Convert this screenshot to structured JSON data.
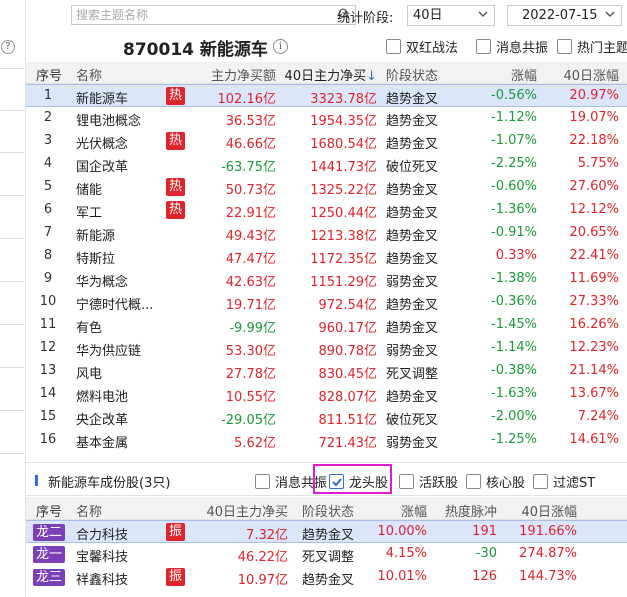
{
  "search": {
    "placeholder": "搜索主题名称"
  },
  "stat": {
    "label": "统计阶段:",
    "period": "40日",
    "date": "2022-07-15"
  },
  "board": {
    "title": "870014 新能源车",
    "options": [
      {
        "label": "双红战法",
        "checked": false
      },
      {
        "label": "消息共振",
        "checked": false
      },
      {
        "label": "热门主题",
        "checked": false
      }
    ]
  },
  "main_table": {
    "headers": {
      "idx": "序号",
      "name": "名称",
      "net": "主力净买额",
      "net40": "40日主力净买",
      "status": "阶段状态",
      "chg": "涨幅",
      "chg40": "40日涨幅"
    },
    "hot_label": "热",
    "rows": [
      {
        "idx": "1",
        "name": "新能源车",
        "hot": true,
        "net": "102.16亿",
        "net_color": "red",
        "net40": "3323.78亿",
        "status": "趋势金叉",
        "chg": "-0.56%",
        "chg_color": "green",
        "chg40": "20.97%"
      },
      {
        "idx": "2",
        "name": "锂电池概念",
        "hot": false,
        "net": "36.53亿",
        "net_color": "red",
        "net40": "1954.35亿",
        "status": "趋势金叉",
        "chg": "-1.12%",
        "chg_color": "green",
        "chg40": "19.07%"
      },
      {
        "idx": "3",
        "name": "光伏概念",
        "hot": true,
        "net": "46.66亿",
        "net_color": "red",
        "net40": "1680.54亿",
        "status": "趋势金叉",
        "chg": "-1.07%",
        "chg_color": "green",
        "chg40": "22.18%"
      },
      {
        "idx": "4",
        "name": "国企改革",
        "hot": false,
        "net": "-63.75亿",
        "net_color": "green",
        "net40": "1441.73亿",
        "status": "破位死叉",
        "chg": "-2.25%",
        "chg_color": "green",
        "chg40": "5.75%"
      },
      {
        "idx": "5",
        "name": "储能",
        "hot": true,
        "net": "50.73亿",
        "net_color": "red",
        "net40": "1325.22亿",
        "status": "趋势金叉",
        "chg": "-0.60%",
        "chg_color": "green",
        "chg40": "27.60%"
      },
      {
        "idx": "6",
        "name": "军工",
        "hot": true,
        "net": "22.91亿",
        "net_color": "red",
        "net40": "1250.44亿",
        "status": "趋势金叉",
        "chg": "-1.36%",
        "chg_color": "green",
        "chg40": "12.12%"
      },
      {
        "idx": "7",
        "name": "新能源",
        "hot": false,
        "net": "49.43亿",
        "net_color": "red",
        "net40": "1213.38亿",
        "status": "趋势金叉",
        "chg": "-0.91%",
        "chg_color": "green",
        "chg40": "20.65%"
      },
      {
        "idx": "8",
        "name": "特斯拉",
        "hot": false,
        "net": "47.47亿",
        "net_color": "red",
        "net40": "1172.35亿",
        "status": "趋势金叉",
        "chg": "0.33%",
        "chg_color": "red",
        "chg40": "22.41%"
      },
      {
        "idx": "9",
        "name": "华为概念",
        "hot": false,
        "net": "42.63亿",
        "net_color": "red",
        "net40": "1151.29亿",
        "status": "弱势金叉",
        "chg": "-1.38%",
        "chg_color": "green",
        "chg40": "11.69%"
      },
      {
        "idx": "10",
        "name": "宁德时代概...",
        "hot": false,
        "net": "19.71亿",
        "net_color": "red",
        "net40": "972.54亿",
        "status": "趋势金叉",
        "chg": "-0.36%",
        "chg_color": "green",
        "chg40": "27.33%"
      },
      {
        "idx": "11",
        "name": "有色",
        "hot": false,
        "net": "-9.99亿",
        "net_color": "green",
        "net40": "960.17亿",
        "status": "趋势金叉",
        "chg": "-1.45%",
        "chg_color": "green",
        "chg40": "16.26%"
      },
      {
        "idx": "12",
        "name": "华为供应链",
        "hot": false,
        "net": "53.30亿",
        "net_color": "red",
        "net40": "890.78亿",
        "status": "弱势金叉",
        "chg": "-1.14%",
        "chg_color": "green",
        "chg40": "12.23%"
      },
      {
        "idx": "13",
        "name": "风电",
        "hot": false,
        "net": "27.78亿",
        "net_color": "red",
        "net40": "830.45亿",
        "status": "死叉调整",
        "chg": "-0.38%",
        "chg_color": "green",
        "chg40": "21.14%"
      },
      {
        "idx": "14",
        "name": "燃料电池",
        "hot": false,
        "net": "10.55亿",
        "net_color": "red",
        "net40": "828.07亿",
        "status": "趋势金叉",
        "chg": "-1.63%",
        "chg_color": "green",
        "chg40": "13.67%"
      },
      {
        "idx": "15",
        "name": "央企改革",
        "hot": false,
        "net": "-29.05亿",
        "net_color": "green",
        "net40": "811.51亿",
        "status": "破位死叉",
        "chg": "-2.00%",
        "chg_color": "green",
        "chg40": "7.24%"
      },
      {
        "idx": "16",
        "name": "基本金属",
        "hot": false,
        "net": "5.62亿",
        "net_color": "red",
        "net40": "721.43亿",
        "status": "弱势金叉",
        "chg": "-1.25%",
        "chg_color": "green",
        "chg40": "14.61%"
      }
    ]
  },
  "constituents": {
    "title": "新能源车成份股(3只)",
    "filters": [
      {
        "label": "消息共振",
        "checked": false
      },
      {
        "label": "龙头股",
        "checked": true
      },
      {
        "label": "活跃股",
        "checked": false
      },
      {
        "label": "核心股",
        "checked": false
      },
      {
        "label": "过滤ST",
        "checked": false
      }
    ],
    "headers": {
      "idx": "序号",
      "name": "名称",
      "net40": "40日主力净买",
      "status": "阶段状态",
      "chg": "涨幅",
      "heat": "热度脉冲",
      "chg40": "40日涨幅"
    },
    "zhen_label": "振",
    "rows": [
      {
        "tag": "龙二",
        "name": "合力科技",
        "zhen": true,
        "net40": "7.32亿",
        "status": "趋势金叉",
        "chg": "10.00%",
        "heat": "191",
        "heat_color": "red",
        "chg40": "191.66%"
      },
      {
        "tag": "龙一",
        "name": "宝馨科技",
        "zhen": false,
        "net40": "46.22亿",
        "status": "死叉调整",
        "chg": "4.15%",
        "heat": "-30",
        "heat_color": "green",
        "chg40": "274.87%"
      },
      {
        "tag": "龙三",
        "name": "祥鑫科技",
        "zhen": true,
        "net40": "10.97亿",
        "status": "趋势金叉",
        "chg": "10.01%",
        "heat": "126",
        "heat_color": "red",
        "chg40": "144.73%"
      }
    ]
  },
  "colors": {
    "red": "#e0242b",
    "green": "#1a9a3a",
    "accent": "#2f6fd6",
    "highlight": "#e01bd0",
    "tag": "#7b3fb8"
  }
}
